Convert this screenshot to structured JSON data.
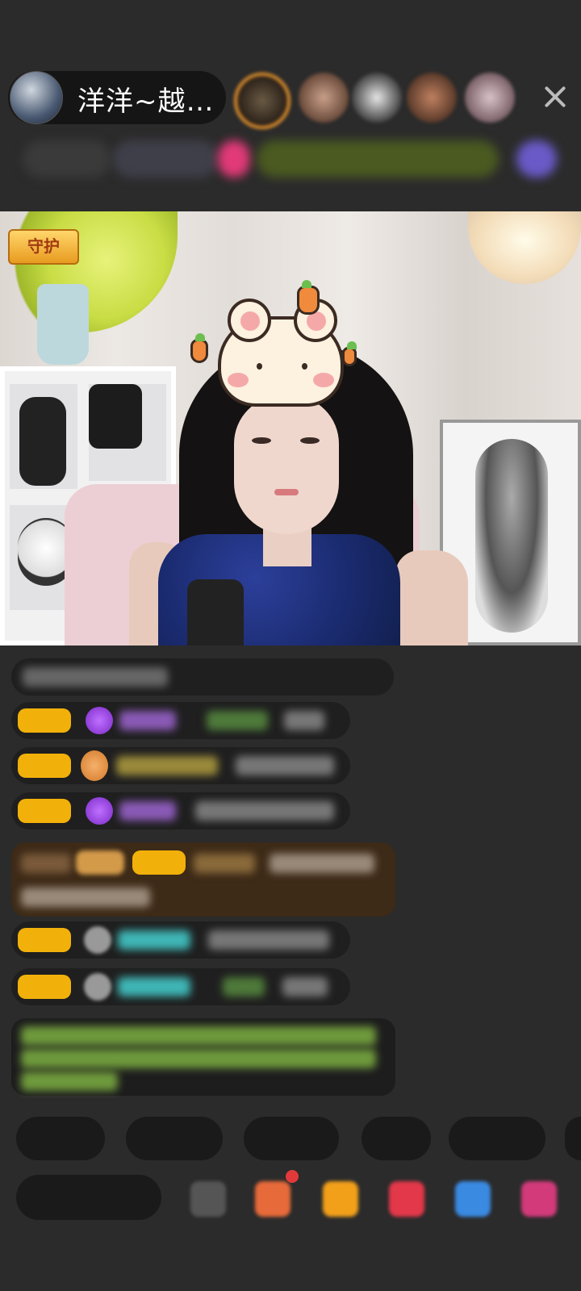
{
  "header": {
    "host_name": "洋洋~越…",
    "close_icon": "close-icon",
    "viewer_avatars": [
      "viewer-avatar",
      "viewer-avatar",
      "viewer-avatar",
      "viewer-avatar",
      "viewer-avatar"
    ]
  },
  "stream": {
    "guard_badge": "守护"
  },
  "chat": {
    "messages": [
      "",
      "",
      "",
      "",
      "",
      "",
      "",
      ""
    ]
  },
  "quick_replies": [
    "",
    "",
    "",
    "",
    "",
    ""
  ],
  "bottom_bar": {
    "input_placeholder": "",
    "icons": [
      "emoji-icon",
      "gift-box-icon",
      "gift-icon",
      "game-icon",
      "chat-icon",
      "more-icon"
    ]
  },
  "colors": {
    "background": "#2b2b2b",
    "chip_yellow": "#f2b10a",
    "gift_message_bg": "#3d2a17",
    "accent_purple": "#8a3fd1",
    "accent_teal": "#3fb5b5",
    "accent_green": "#9ccc65"
  }
}
